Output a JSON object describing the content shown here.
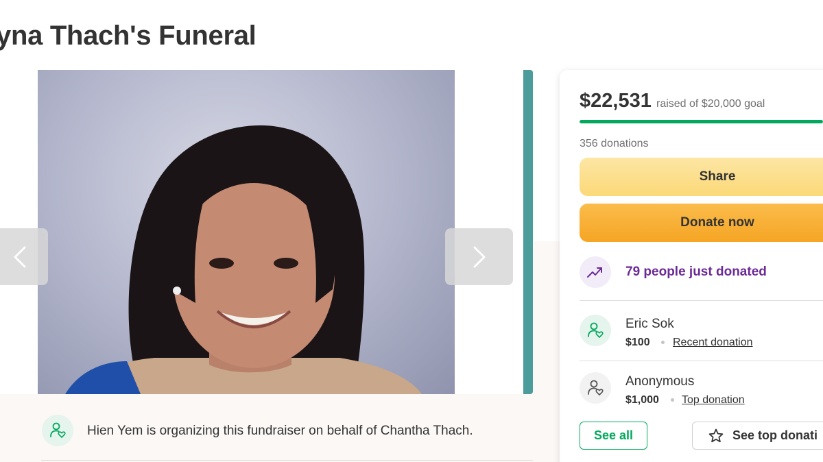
{
  "page": {
    "title": "yna Thach's Funeral"
  },
  "fundraiser": {
    "raised": "$22,531",
    "raised_of": "raised of $20,000 goal",
    "progress_fraction": 1.0,
    "donation_count": "356 donations",
    "share_label": "Share",
    "donate_label": "Donate now",
    "trending_text": "79 people just donated",
    "donations": [
      {
        "name": "Eric Sok",
        "amount": "$100",
        "tag": "Recent donation"
      },
      {
        "name": "Anonymous",
        "amount": "$1,000",
        "tag": "Top donation"
      }
    ],
    "see_all_label": "See all",
    "see_top_label": "See top donati"
  },
  "organizer": {
    "text": "Hien Yem is organizing this fundraiser on behalf of Chantha Thach."
  },
  "icons": {
    "carousel_prev": "chevron-left-icon",
    "carousel_next": "chevron-right-icon",
    "organizer": "heart-user-icon",
    "trending": "trending-up-icon",
    "donor": "heart-user-icon",
    "star": "star-icon"
  },
  "colors": {
    "green": "#02a95c",
    "purple": "#6b2a95",
    "share_yellow": "#fbd978",
    "donate_orange": "#f5a524",
    "teal_edge": "#4c9c9c"
  }
}
